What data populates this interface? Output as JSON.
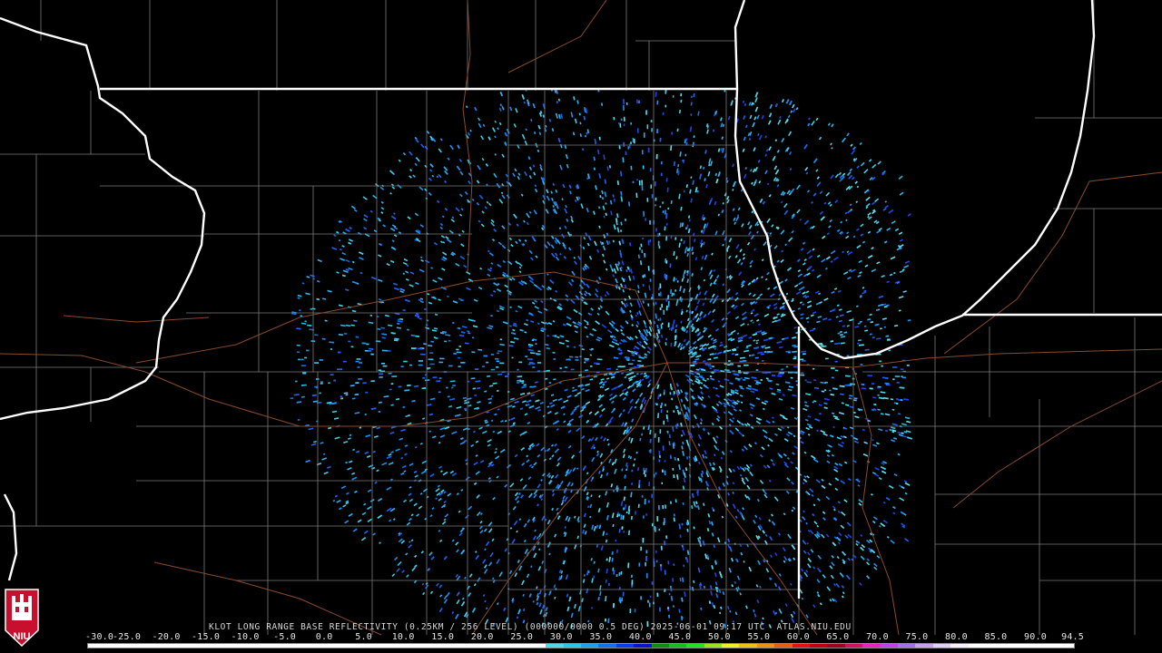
{
  "caption": "KLOT LONG RANGE BASE REFLECTIVITY (0.25KM / 256 LEVEL) (000000/0000 0.5 DEG) 2025-06-01 09:17 UTC  ATLAS.NIU.EDU",
  "logo_text": "NIU",
  "scale": {
    "ticks": [
      "-30.0",
      "-25.0",
      "-20.0",
      "-15.0",
      "-10.0",
      "-5.0",
      "0.0",
      "5.0",
      "10.0",
      "15.0",
      "20.0",
      "25.0",
      "30.0",
      "35.0",
      "40.0",
      "45.0",
      "50.0",
      "55.0",
      "60.0",
      "65.0",
      "70.0",
      "75.0",
      "80.0",
      "85.0",
      "90.0",
      "94.5"
    ],
    "colors": [
      "#ffffff",
      "#ffffff",
      "#ffffff",
      "#ffffff",
      "#ffffff",
      "#ffffff",
      "#ffffff",
      "#ffffff",
      "#ffffff",
      "#ffffff",
      "#ffffff",
      "#ffffff",
      "#ffffff",
      "#ffffff",
      "#ffffff",
      "#ffffff",
      "#ffffff",
      "#ffffff",
      "#ffffff",
      "#ffffff",
      "#ffffff",
      "#ffffff",
      "#ffffff",
      "#ffffff",
      "#ffffff",
      "#ffffff",
      "#4fd8e8",
      "#27c9e6",
      "#1aa2ee",
      "#1270f2",
      "#0a3cf4",
      "#0a14c8",
      "#0d8f10",
      "#10c020",
      "#22e022",
      "#9be21b",
      "#f0f020",
      "#f0c010",
      "#f09010",
      "#f05a10",
      "#e81010",
      "#c00010",
      "#a00020",
      "#d01060",
      "#f020c0",
      "#c040f0",
      "#a070f0",
      "#c8a0f0",
      "#e0d0f8",
      "#f8f0ff",
      "#ffffff",
      "#ffffff",
      "#ffffff",
      "#ffffff",
      "#ffffff",
      "#ffffff"
    ]
  }
}
